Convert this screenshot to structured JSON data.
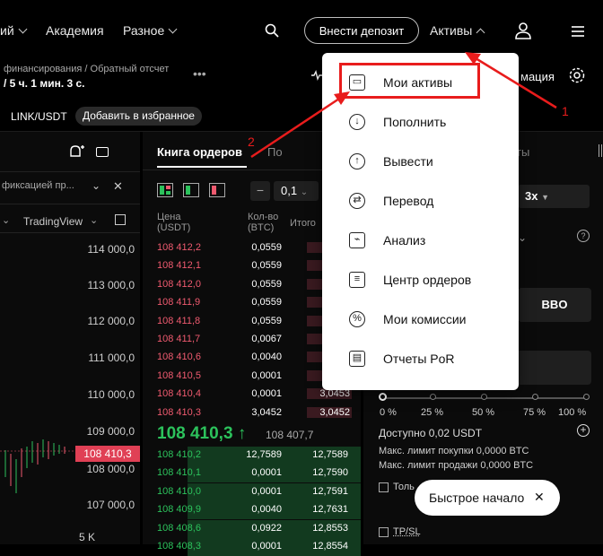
{
  "nav": {
    "item1": "ий",
    "academy": "Академия",
    "misc": "Разное",
    "deposit": "Внести депозит",
    "assets": "Активы"
  },
  "sub1": {
    "line1": "финансирования / Обратный отсчет",
    "line2": "/ 5 ч. 1 мин. 3 с.",
    "right": "мация"
  },
  "sub2": {
    "pair": "LINK/USDT",
    "favorite": "Добавить в избранное"
  },
  "left_panel": {
    "filter": "фиксацией пр...",
    "tradingview": "TradingView",
    "axis": [
      "114 000,0",
      "113 000,0",
      "112 000,0",
      "111 000,0",
      "110 000,0",
      "109 000,0",
      "108 000,0",
      "107 000,0",
      "5 K"
    ],
    "last_price_tag": "108 410,3"
  },
  "orderbook": {
    "tab_active": "Книга ордеров",
    "tab_next": "По",
    "tick": "0,1",
    "col_price": "Цена\n(USDT)",
    "col_price_1": "Цена",
    "col_price_2": "(USDT)",
    "col_qty_1": "Кол-во",
    "col_qty_2": "(BTC)",
    "col_total": "Итого",
    "asks": [
      {
        "price": "108 412,2",
        "qty": "0,0559",
        "total": "3,"
      },
      {
        "price": "108 412,1",
        "qty": "0,0559",
        "total": "3,"
      },
      {
        "price": "108 412,0",
        "qty": "0,0559",
        "total": "3,"
      },
      {
        "price": "108 411,9",
        "qty": "0,0559",
        "total": "3,"
      },
      {
        "price": "108 411,8",
        "qty": "0,0559",
        "total": "3,"
      },
      {
        "price": "108 411,7",
        "qty": "0,0067",
        "total": "3,"
      },
      {
        "price": "108 410,6",
        "qty": "0,0040",
        "total": "3,"
      },
      {
        "price": "108 410,5",
        "qty": "0,0001",
        "total": "3,"
      },
      {
        "price": "108 410,4",
        "qty": "0,0001",
        "total": "3,0453"
      },
      {
        "price": "108 410,3",
        "qty": "3,0452",
        "total": "3,0452"
      }
    ],
    "mid_price": "108 410,3",
    "mid_arrow": "↑",
    "mid_mark": "108 407,7",
    "bids": [
      {
        "price": "108 410,2",
        "qty": "12,7589",
        "total": "12,7589"
      },
      {
        "price": "108 410,1",
        "qty": "0,0001",
        "total": "12,7590"
      },
      {
        "price": "108 410,0",
        "qty": "0,0001",
        "total": "12,7591"
      },
      {
        "price": "108 409,9",
        "qty": "0,0040",
        "total": "12,7631"
      },
      {
        "price": "108 408,6",
        "qty": "0,0922",
        "total": "12,8553"
      },
      {
        "price": "108 408,3",
        "qty": "0,0001",
        "total": "12,8554"
      }
    ]
  },
  "right_panel": {
    "tab": "ты",
    "leverage": "3x",
    "bbo": "BBO",
    "slider_labels": [
      "0 %",
      "25 %",
      "50 %",
      "75 %",
      "100 %"
    ],
    "slider_value": 0,
    "available": "Доступно 0,02 USDT",
    "max_buy": "Макс. лимит покупки 0,0000 BTC",
    "max_sell": "Макс. лимит продажи 0,0000 BTC",
    "only": "Толь",
    "tpsl": "TP/SL"
  },
  "dropdown": {
    "items": [
      {
        "label": "Мои активы",
        "icon": "wallet-icon"
      },
      {
        "label": "Пополнить",
        "icon": "download-icon"
      },
      {
        "label": "Вывести",
        "icon": "upload-icon"
      },
      {
        "label": "Перевод",
        "icon": "transfer-icon"
      },
      {
        "label": "Анализ",
        "icon": "chart-icon"
      },
      {
        "label": "Центр ордеров",
        "icon": "clipboard-icon"
      },
      {
        "label": "Мои комиссии",
        "icon": "discount-icon"
      },
      {
        "label": "Отчеты PoR",
        "icon": "report-icon"
      }
    ]
  },
  "annotations": {
    "num1": "1",
    "num2": "2",
    "color": "#e81c1c"
  },
  "toast": {
    "label": "Быстрое начало"
  }
}
